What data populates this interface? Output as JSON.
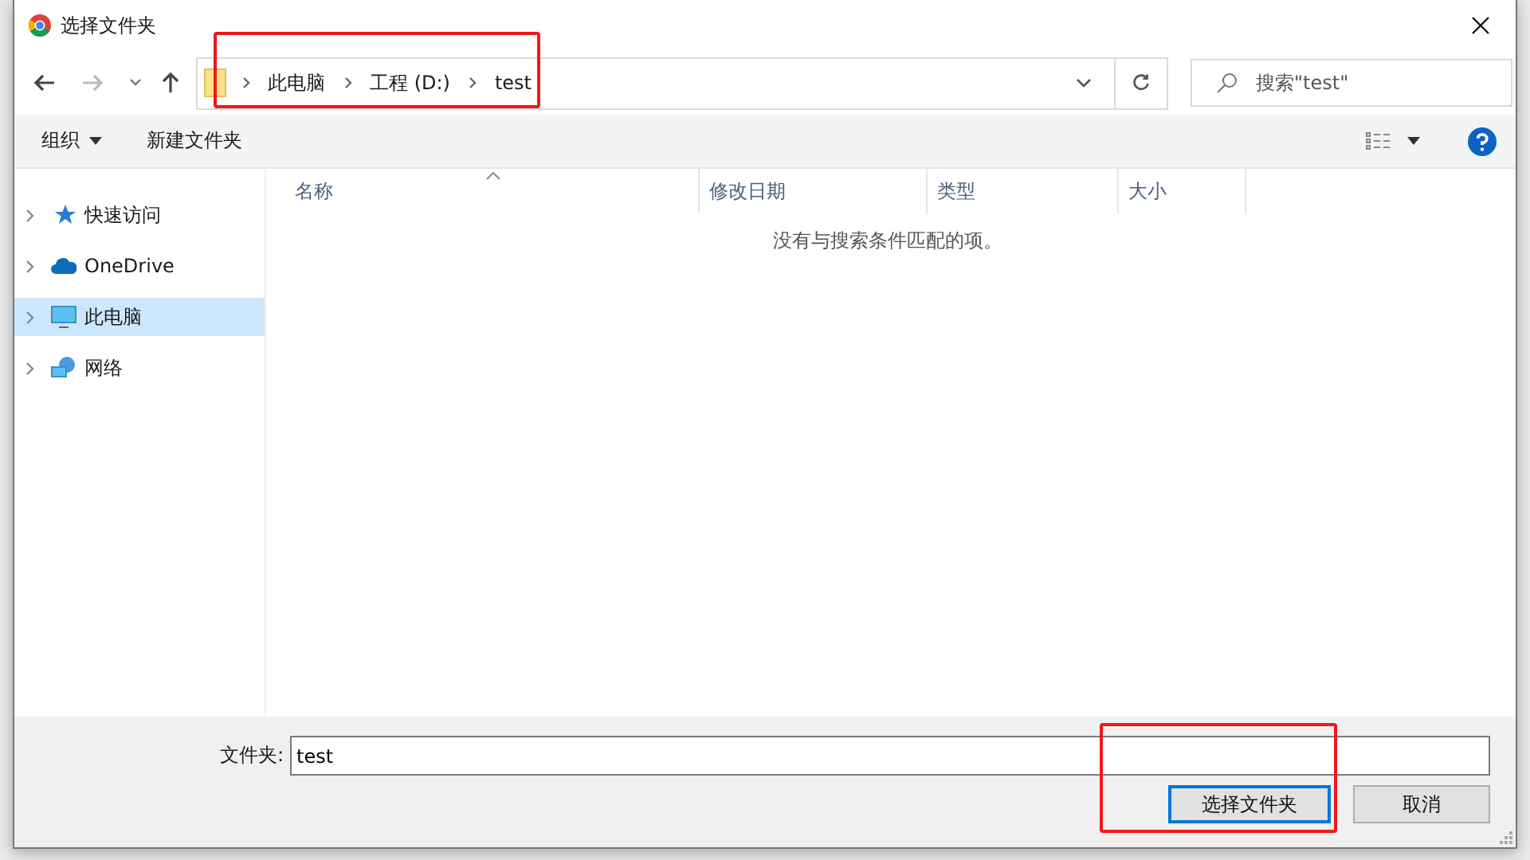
{
  "window": {
    "title": "选择文件夹"
  },
  "nav": {
    "breadcrumb": [
      {
        "label": "此电脑"
      },
      {
        "label": "工程 (D:)"
      },
      {
        "label": "test"
      }
    ],
    "highlighted": true,
    "search": {
      "placeholder": "搜索\"test\""
    }
  },
  "toolbar": {
    "organize": "组织",
    "new_folder": "新建文件夹"
  },
  "sidebar": {
    "items": [
      {
        "label": "快速访问",
        "kind": "star",
        "selected": false
      },
      {
        "label": "OneDrive",
        "kind": "cloud",
        "selected": false
      },
      {
        "label": "此电脑",
        "kind": "pc",
        "selected": true
      },
      {
        "label": "网络",
        "kind": "network",
        "selected": false
      }
    ]
  },
  "table": {
    "columns": [
      {
        "label": "名称",
        "sorted": true
      },
      {
        "label": "修改日期",
        "sorted": false
      },
      {
        "label": "类型",
        "sorted": false
      },
      {
        "label": "大小",
        "sorted": false
      }
    ],
    "empty_message": "没有与搜索条件匹配的项。"
  },
  "footer": {
    "folder_label": "文件夹:",
    "folder_value": "test",
    "highlighted": true,
    "buttons": [
      {
        "label": "选择文件夹",
        "default": true
      },
      {
        "label": "取消",
        "default": false
      }
    ]
  }
}
